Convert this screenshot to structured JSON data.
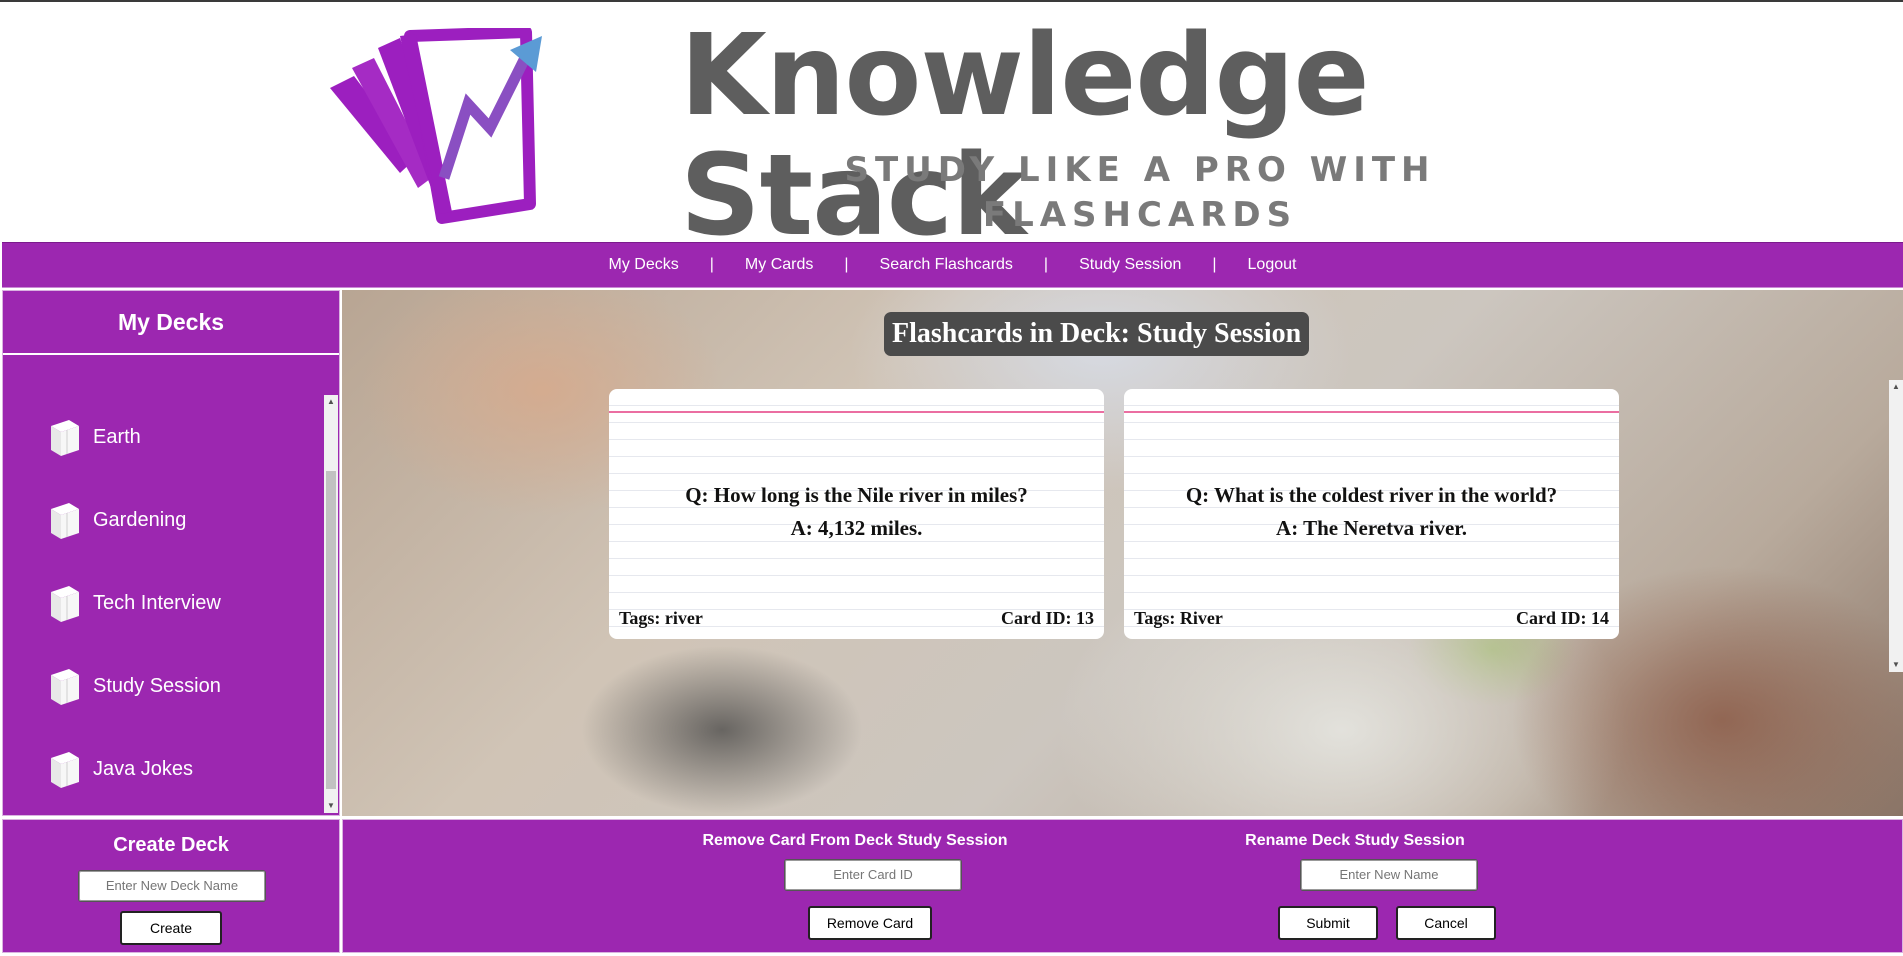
{
  "header": {
    "title": "Knowledge Stack",
    "subtitle": "STUDY LIKE A PRO WITH FLASHCARDS",
    "colors": {
      "logo_purple": "#9c1fbf",
      "arrow_blue": "#5b9bd5"
    }
  },
  "nav": {
    "items": [
      "My Decks",
      "My Cards",
      "Search Flashcards",
      "Study Session",
      "Logout"
    ],
    "separator": "|"
  },
  "sidebar": {
    "title": "My Decks",
    "decks": [
      "Earth",
      "Gardening",
      "Tech Interview",
      "Study Session",
      "Java Jokes"
    ],
    "deck_icon": "deck-box-icon"
  },
  "main": {
    "title": "Flashcards in Deck: Study Session",
    "cards": [
      {
        "question": "Q: How long is the Nile river in miles?",
        "answer": "A: 4,132 miles.",
        "tags": "Tags: river",
        "card_id": "Card ID: 13"
      },
      {
        "question": "Q: What is the coldest river in the world?",
        "answer": "A: The Neretva river.",
        "tags": "Tags: River",
        "card_id": "Card ID: 14"
      }
    ]
  },
  "create": {
    "title": "Create Deck",
    "input_placeholder": "Enter New Deck Name",
    "button": "Create"
  },
  "remove": {
    "title": "Remove Card From Deck Study Session",
    "input_placeholder": "Enter Card ID",
    "button": "Remove Card"
  },
  "rename": {
    "title": "Rename Deck Study Session",
    "input_placeholder": "Enter New Name",
    "submit": "Submit",
    "cancel": "Cancel"
  },
  "theme": {
    "accent": "#9c27b0",
    "title_box": "#4b4b4b"
  }
}
